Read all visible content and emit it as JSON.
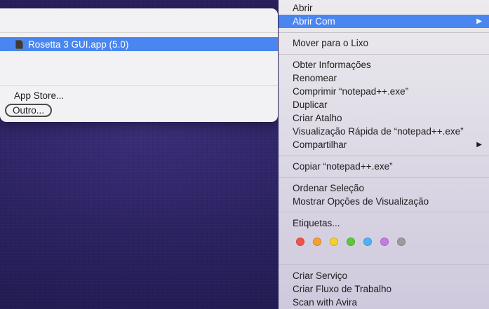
{
  "open_with_panel": {
    "selected_app": "Rosetta 3 GUI.app (5.0)",
    "app_store": "App Store...",
    "other_button": "Outro..."
  },
  "context_menu": {
    "items": [
      {
        "label": "Abrir"
      },
      {
        "label": "Abrir Com",
        "has_submenu": true,
        "highlighted": true
      },
      {
        "label": "Mover para o Lixo"
      },
      {
        "label": "Obter Informações"
      },
      {
        "label": "Renomear"
      },
      {
        "label": "Comprimir “notepad++.exe”"
      },
      {
        "label": "Duplicar"
      },
      {
        "label": "Criar Atalho"
      },
      {
        "label": "Visualização Rápida de “notepad++.exe”"
      },
      {
        "label": "Compartilhar",
        "has_submenu": true
      },
      {
        "label": "Copiar “notepad++.exe”"
      },
      {
        "label": "Ordenar Seleção"
      },
      {
        "label": "Mostrar Opções de Visualização"
      },
      {
        "label": "Etiquetas..."
      },
      {
        "label": "Criar Serviço"
      },
      {
        "label": "Criar Fluxo de Trabalho"
      },
      {
        "label": "Scan with Avira"
      }
    ],
    "submenu_arrow": "▶",
    "tag_colors": [
      "#f0534b",
      "#f5a033",
      "#f5d02e",
      "#5cc93b",
      "#4fb2f5",
      "#c77ae4",
      "#9c9c9c"
    ]
  },
  "accent_color": "#4a86f0"
}
